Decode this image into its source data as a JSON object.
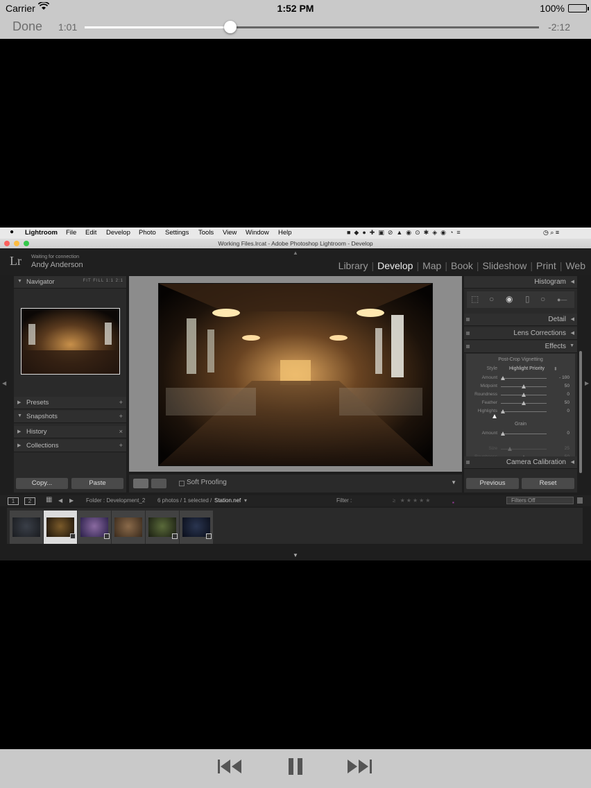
{
  "status_bar": {
    "carrier": "Carrier",
    "time": "1:52 PM",
    "battery": "100%"
  },
  "player": {
    "done_label": "Done",
    "elapsed": "1:01",
    "remaining": "-2:12",
    "progress": 0.32
  },
  "mac_menu": {
    "app": "Lightroom",
    "items": [
      "File",
      "Edit",
      "Develop",
      "Photo",
      "Settings",
      "Tools",
      "View",
      "Window",
      "Help"
    ]
  },
  "window": {
    "title": "Working Files.lrcat - Adobe Photoshop Lightroom - Develop"
  },
  "lightroom": {
    "logo": "Lr",
    "identity_status": "Waiting for connection",
    "identity_name": "Andy Anderson",
    "modules": [
      "Library",
      "Develop",
      "Map",
      "Book",
      "Slideshow",
      "Print",
      "Web"
    ],
    "active_module": "Develop"
  },
  "left_panel": {
    "navigator": {
      "label": "Navigator",
      "options": "FIT  FILL  1:1  2:1"
    },
    "presets": {
      "label": "Presets",
      "action": "+"
    },
    "snapshots": {
      "label": "Snapshots",
      "action": "+"
    },
    "history": {
      "label": "History",
      "action": "×"
    },
    "collections": {
      "label": "Collections",
      "action": "+"
    },
    "copy_label": "Copy...",
    "paste_label": "Paste"
  },
  "toolbar": {
    "soft_proofing_label": "Soft Proofing"
  },
  "right_panel": {
    "histogram": "Histogram",
    "detail": "Detail",
    "lens_corrections": "Lens Corrections",
    "effects": "Effects",
    "vignetting_title": "Post-Crop Vignetting",
    "style_label": "Style",
    "style_value": "Highlight Priority",
    "vignette_sliders": [
      {
        "name": "Amount",
        "value": "- 100",
        "pos": 0.05
      },
      {
        "name": "Midpoint",
        "value": "50",
        "pos": 0.5
      },
      {
        "name": "Roundness",
        "value": "0",
        "pos": 0.5
      },
      {
        "name": "Feather",
        "value": "50",
        "pos": 0.5
      },
      {
        "name": "Highlights",
        "value": "0",
        "pos": 0.05
      }
    ],
    "grain_title": "Grain",
    "grain_sliders": [
      {
        "name": "Amount",
        "value": "0",
        "pos": 0.05
      }
    ],
    "camera_calibration": "Camera Calibration",
    "previous_label": "Previous",
    "reset_label": "Reset"
  },
  "filmstrip_bar": {
    "page1": "1",
    "page2": "2",
    "folder": "Folder : Development_2",
    "count": "6 photos / 1 selected /",
    "file": "Station.nef",
    "filter_label": "Filter :",
    "filters_off": "Filters Off"
  },
  "filmstrip": {
    "thumbs": [
      {
        "colors": [
          "#3a3f48",
          "#1a1c20"
        ],
        "selected": false,
        "badge": false
      },
      {
        "colors": [
          "#7a5a2a",
          "#1c140a"
        ],
        "selected": true,
        "badge": true
      },
      {
        "colors": [
          "#8a6aa0",
          "#2a1f4a"
        ],
        "selected": false,
        "badge": true
      },
      {
        "colors": [
          "#8a6a4a",
          "#3a2a1c"
        ],
        "selected": false,
        "badge": false
      },
      {
        "colors": [
          "#5a6a3a",
          "#1a1e12"
        ],
        "selected": false,
        "badge": true
      },
      {
        "colors": [
          "#2a3550",
          "#0a0e1a"
        ],
        "selected": false,
        "badge": true
      }
    ]
  },
  "colors": {
    "ios_bar": "#c9c9c9",
    "lr_bg": "#1f1f1f",
    "panel": "#2a2a2a"
  },
  "icons": {
    "rewind": "⏮",
    "pause": "⏸",
    "fast_forward": "⏭"
  }
}
